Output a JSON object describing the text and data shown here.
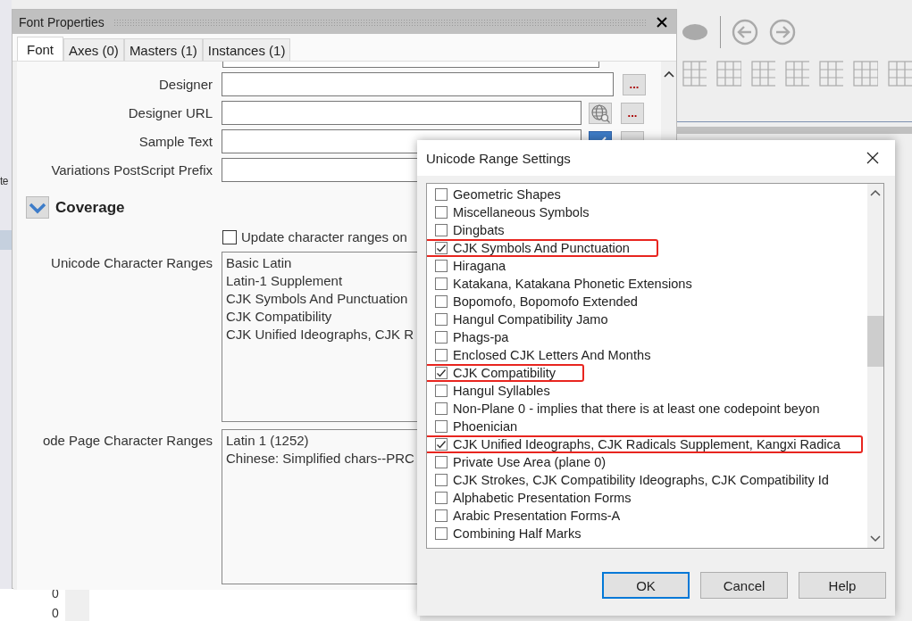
{
  "background_app": {
    "side_text": "te",
    "cells": [
      "0",
      "0"
    ]
  },
  "font_properties": {
    "title": "Font Properties",
    "tabs": [
      {
        "label": "Font",
        "selected": true
      },
      {
        "label": "Axes (0)",
        "selected": false
      },
      {
        "label": "Masters (1)",
        "selected": false
      },
      {
        "label": "Instances (1)",
        "selected": false
      }
    ],
    "fields": [
      {
        "label": "Designer",
        "buttons": [
          {
            "kind": "browse",
            "text": "..."
          }
        ]
      },
      {
        "label": "Designer URL",
        "buttons": [
          {
            "kind": "globe"
          },
          {
            "kind": "browse",
            "text": "..."
          }
        ]
      },
      {
        "label": "Sample Text",
        "buttons": [
          {
            "kind": "toggle",
            "on": true
          },
          {
            "kind": "browse"
          }
        ]
      },
      {
        "label": "Variations PostScript Prefix"
      }
    ],
    "coverage": {
      "title": "Coverage",
      "expanded": true,
      "update_checkbox": {
        "label": "Update character ranges on",
        "checked": false
      },
      "unicode_ranges": {
        "label": "Unicode Character Ranges",
        "items": [
          "Basic Latin",
          "Latin-1 Supplement",
          "CJK Symbols And Punctuation",
          "CJK Compatibility",
          "CJK Unified Ideographs, CJK R"
        ]
      },
      "code_page_ranges": {
        "label": "ode Page Character Ranges",
        "items": [
          "Latin 1 (1252)",
          "Chinese: Simplified chars--PRC"
        ]
      }
    }
  },
  "unicode_dialog": {
    "title": "Unicode Range Settings",
    "ranges": [
      {
        "name": "Geometric Shapes",
        "checked": false,
        "highlighted": false
      },
      {
        "name": "Miscellaneous Symbols",
        "checked": false,
        "highlighted": false
      },
      {
        "name": "Dingbats",
        "checked": false,
        "highlighted": false
      },
      {
        "name": "CJK Symbols And Punctuation",
        "checked": true,
        "highlighted": true
      },
      {
        "name": "Hiragana",
        "checked": false,
        "highlighted": false
      },
      {
        "name": "Katakana, Katakana Phonetic Extensions",
        "checked": false,
        "highlighted": false
      },
      {
        "name": "Bopomofo, Bopomofo Extended",
        "checked": false,
        "highlighted": false
      },
      {
        "name": "Hangul Compatibility Jamo",
        "checked": false,
        "highlighted": false
      },
      {
        "name": "Phags-pa",
        "checked": false,
        "highlighted": false
      },
      {
        "name": "Enclosed CJK Letters And Months",
        "checked": false,
        "highlighted": false
      },
      {
        "name": "CJK Compatibility",
        "checked": true,
        "highlighted": true
      },
      {
        "name": "Hangul Syllables",
        "checked": false,
        "highlighted": false
      },
      {
        "name": "Non-Plane 0 - implies that there is at least one codepoint beyon",
        "checked": false,
        "highlighted": false
      },
      {
        "name": "Phoenician",
        "checked": false,
        "highlighted": false
      },
      {
        "name": "CJK Unified Ideographs, CJK Radicals Supplement, Kangxi Radica",
        "checked": true,
        "highlighted": true
      },
      {
        "name": "Private Use Area (plane 0)",
        "checked": false,
        "highlighted": false
      },
      {
        "name": "CJK Strokes, CJK Compatibility Ideographs, CJK Compatibility Id",
        "checked": false,
        "highlighted": false
      },
      {
        "name": "Alphabetic Presentation Forms",
        "checked": false,
        "highlighted": false
      },
      {
        "name": "Arabic Presentation Forms-A",
        "checked": false,
        "highlighted": false
      },
      {
        "name": "Combining Half Marks",
        "checked": false,
        "highlighted": false
      }
    ],
    "buttons": [
      {
        "label": "OK",
        "default": true
      },
      {
        "label": "Cancel",
        "default": false
      },
      {
        "label": "Help",
        "default": false
      }
    ]
  }
}
